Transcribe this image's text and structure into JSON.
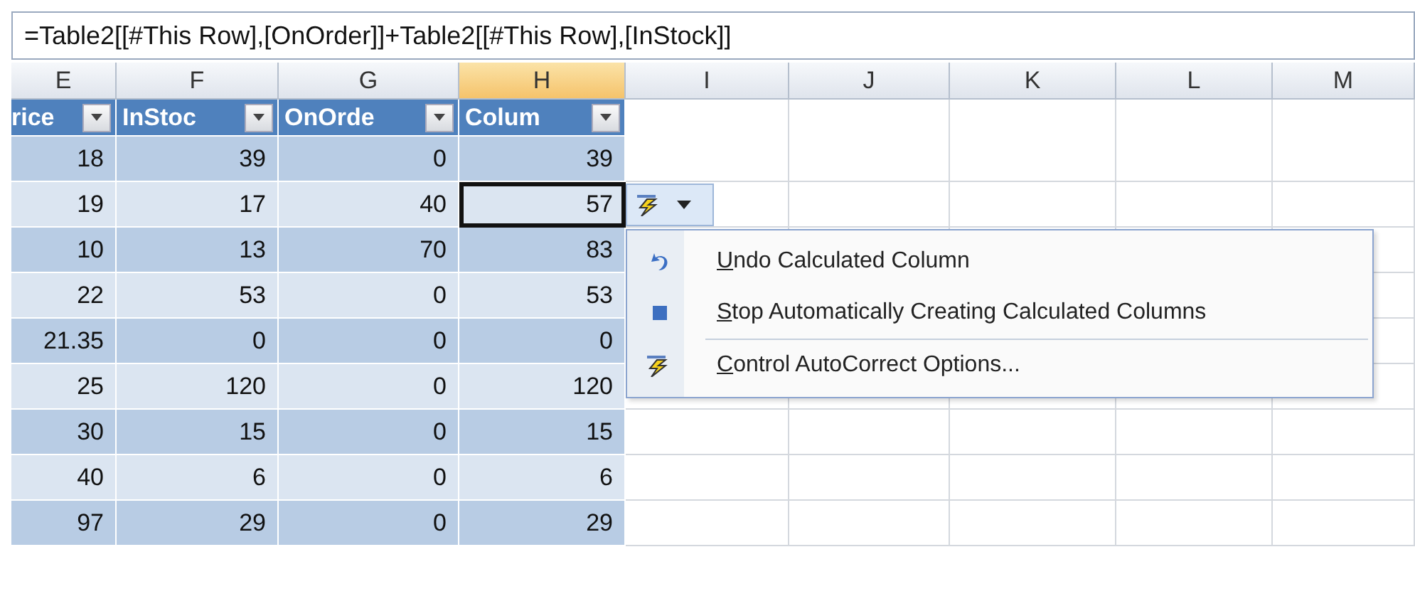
{
  "formula_bar": {
    "value": "=Table2[[#This Row],[OnOrder]]+Table2[[#This Row],[InStock]]"
  },
  "columns": [
    {
      "label": "E",
      "selected": false
    },
    {
      "label": "F",
      "selected": false
    },
    {
      "label": "G",
      "selected": false
    },
    {
      "label": "H",
      "selected": true
    },
    {
      "label": "I",
      "selected": false
    },
    {
      "label": "J",
      "selected": false
    },
    {
      "label": "K",
      "selected": false
    },
    {
      "label": "L",
      "selected": false
    },
    {
      "label": "M",
      "selected": false
    }
  ],
  "table": {
    "headers": [
      "rice",
      "InStoc",
      "OnOrde",
      "Colum"
    ],
    "rows": [
      {
        "cells": [
          {
            "text": "18",
            "selected": false
          },
          {
            "text": "39",
            "selected": false
          },
          {
            "text": "0",
            "selected": false
          },
          {
            "text": "39",
            "selected": false
          }
        ]
      },
      {
        "cells": [
          {
            "text": "19",
            "selected": false
          },
          {
            "text": "17",
            "selected": false
          },
          {
            "text": "40",
            "selected": false
          },
          {
            "text": "57",
            "selected": true
          }
        ]
      },
      {
        "cells": [
          {
            "text": "10",
            "selected": false
          },
          {
            "text": "13",
            "selected": false
          },
          {
            "text": "70",
            "selected": false
          },
          {
            "text": "83",
            "selected": false
          }
        ]
      },
      {
        "cells": [
          {
            "text": "22",
            "selected": false
          },
          {
            "text": "53",
            "selected": false
          },
          {
            "text": "0",
            "selected": false
          },
          {
            "text": "53",
            "selected": false
          }
        ]
      },
      {
        "cells": [
          {
            "text": "21.35",
            "selected": false
          },
          {
            "text": "0",
            "selected": false
          },
          {
            "text": "0",
            "selected": false
          },
          {
            "text": "0",
            "selected": false
          }
        ]
      },
      {
        "cells": [
          {
            "text": "25",
            "selected": false
          },
          {
            "text": "120",
            "selected": false
          },
          {
            "text": "0",
            "selected": false
          },
          {
            "text": "120",
            "selected": false
          }
        ]
      },
      {
        "cells": [
          {
            "text": "30",
            "selected": false
          },
          {
            "text": "15",
            "selected": false
          },
          {
            "text": "0",
            "selected": false
          },
          {
            "text": "15",
            "selected": false
          }
        ]
      },
      {
        "cells": [
          {
            "text": "40",
            "selected": false
          },
          {
            "text": "6",
            "selected": false
          },
          {
            "text": "0",
            "selected": false
          },
          {
            "text": "6",
            "selected": false
          }
        ]
      },
      {
        "cells": [
          {
            "text": "97",
            "selected": false
          },
          {
            "text": "29",
            "selected": false
          },
          {
            "text": "0",
            "selected": false
          },
          {
            "text": "29",
            "selected": false
          }
        ]
      }
    ]
  },
  "smart_tag": {
    "expanded": true,
    "menu": [
      {
        "kind": "undo",
        "key": "U",
        "label": "ndo Calculated Column",
        "separator_before": false
      },
      {
        "kind": "stop",
        "key": "S",
        "label": "top Automatically Creating Calculated Columns",
        "separator_before": false
      },
      {
        "kind": "options",
        "key": "C",
        "label": "ontrol AutoCorrect Options...",
        "separator_before": true
      }
    ]
  }
}
